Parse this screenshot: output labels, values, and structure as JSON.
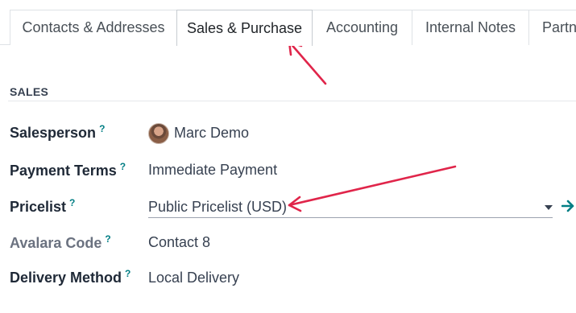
{
  "tabs": [
    {
      "label": "Contacts & Addresses"
    },
    {
      "label": "Sales & Purchase"
    },
    {
      "label": "Accounting"
    },
    {
      "label": "Internal Notes"
    },
    {
      "label": "Partn"
    }
  ],
  "section": {
    "title": "SALES"
  },
  "fields": {
    "salesperson": {
      "label": "Salesperson",
      "help": "?",
      "value": "Marc Demo"
    },
    "payment_terms": {
      "label": "Payment Terms",
      "help": "?",
      "value": "Immediate Payment"
    },
    "pricelist": {
      "label": "Pricelist",
      "help": "?",
      "value": "Public Pricelist (USD)"
    },
    "avalara_code": {
      "label": "Avalara Code",
      "help": "?",
      "value": "Contact 8"
    },
    "delivery_method": {
      "label": "Delivery Method",
      "help": "?",
      "value": "Local Delivery"
    }
  },
  "icons": {
    "avatar": "user-avatar",
    "dropdown": "caret-down-icon",
    "internal_link": "arrow-right-icon"
  },
  "colors": {
    "annotation_arrow": "#e0254a",
    "help_marker": "#017e84",
    "internal_link": "#017e84"
  }
}
